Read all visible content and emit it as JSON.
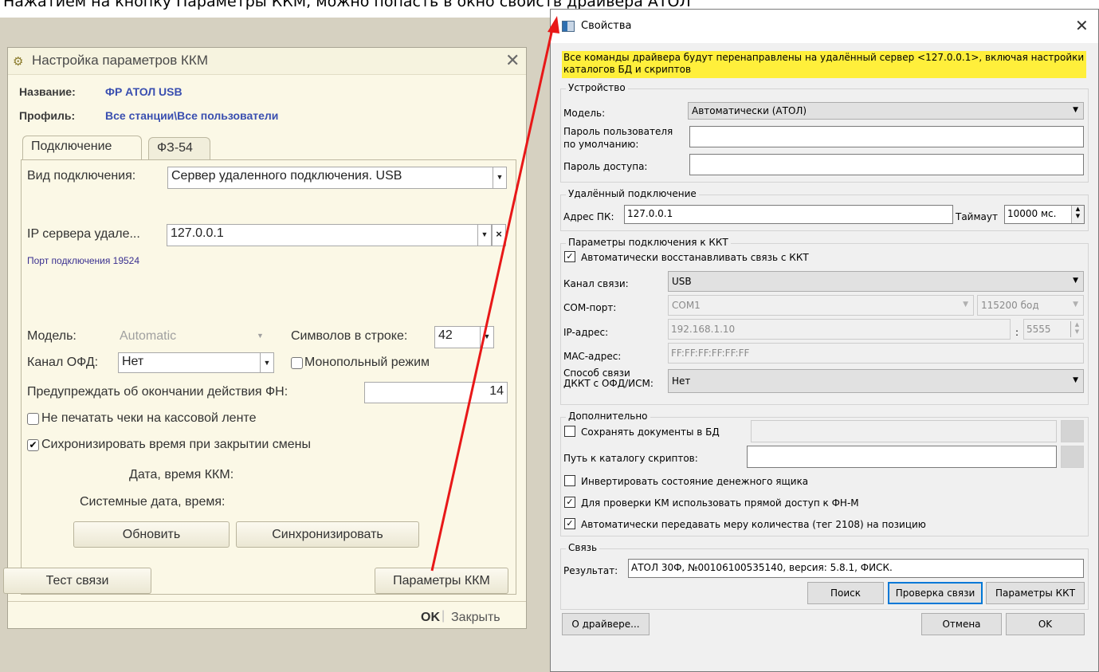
{
  "caption": "Нажатием на кнопку Параметры ККМ, можно попасть в окно свойств драйвера АТОЛ",
  "kkm": {
    "title": "Настройка параметров ККМ",
    "name_label": "Название:",
    "name_value": "ФР АТОЛ USB",
    "profile_label": "Профиль:",
    "profile_value": "Все станции\\Все пользователи",
    "tabs": [
      "Подключение",
      "ФЗ-54"
    ],
    "conn_type_label": "Вид подключения:",
    "conn_type_value": "Сервер удаленного подключения. USB",
    "ip_label": "IP сервера удале...",
    "ip_value": "127.0.0.1",
    "port_text": "Порт подключения 19524",
    "model_label": "Модель:",
    "model_value": "Automatic",
    "chars_label": "Символов в строке:",
    "chars_value": "42",
    "ofd_label": "Канал ОФД:",
    "ofd_value": "Нет",
    "monopoly_label": "Монопольный режим",
    "warn_fn_label": "Предупреждать об окончании действия ФН:",
    "warn_fn_value": "14",
    "no_print_label": "Не печатать чеки на кассовой ленте",
    "sync_time_label": "Сихронизировать время при закрытии смены",
    "kkm_datetime_label": "Дата, время ККМ:",
    "sys_datetime_label": "Системные дата, время:",
    "refresh_button": "Обновить",
    "sync_button": "Синхронизировать",
    "test_button": "Тест связи",
    "params_button": "Параметры ККМ",
    "ok_button": "OK",
    "close_button": "Закрыть"
  },
  "props": {
    "title": "Свойства",
    "warning": "Все команды драйвера будут перенаправлены на удалённый сервер <127.0.0.1>, включая настройки каталогов БД и скриптов",
    "device_group": "Устройство",
    "model_label": "Модель:",
    "model_value": "Автоматически (АТОЛ)",
    "user_pass_label_1": "Пароль пользователя",
    "user_pass_label_2": "по умолчанию:",
    "access_pass_label": "Пароль доступа:",
    "remote_group": "Удалённый подключение",
    "pc_addr_label": "Адрес ПК:",
    "pc_addr_value": "127.0.0.1",
    "timeout_label": "Таймаут",
    "timeout_value": "10000 мс.",
    "kkt_group": "Параметры подключения к ККТ",
    "auto_reconnect_label": "Автоматически восстанавливать связь с ККТ",
    "channel_label": "Канал связи:",
    "channel_value": "USB",
    "com_label": "COM-порт:",
    "com_value": "COM1",
    "baud_value": "115200 бод",
    "ip_label": "IP-адрес:",
    "ip_value": "192.168.1.10",
    "ip_port_sep": ":",
    "ip_port_value": "5555",
    "mac_label": "MAC-адрес:",
    "mac_value": "FF:FF:FF:FF:FF:FF",
    "ofd_label_1": "Способ связи",
    "ofd_label_2": "ДККТ с ОФД/ИСМ:",
    "ofd_value": "Нет",
    "extra_group": "Дополнительно",
    "save_docs_label": "Сохранять документы в БД",
    "scripts_label": "Путь к каталогу скриптов:",
    "invert_label": "Инвертировать состояние денежного ящика",
    "direct_fn_label": "Для проверки КМ использовать прямой доступ к ФН-М",
    "auto_measure_label": "Автоматически передавать меру количества (тег 2108) на позицию",
    "link_group": "Связь",
    "result_label": "Результат:",
    "result_value": "АТОЛ 30Ф, №00106100535140, версия: 5.8.1, ФИСК.",
    "search_button": "Поиск",
    "check_button": "Проверка связи",
    "kkt_params_button": "Параметры ККТ",
    "about_button": "О драйвере...",
    "cancel_button": "Отмена",
    "ok_button": "OK"
  },
  "colors": {
    "arrow": "#e81818",
    "warning_bg": "#ffef3b",
    "accent_blue": "#3a4fb0"
  }
}
